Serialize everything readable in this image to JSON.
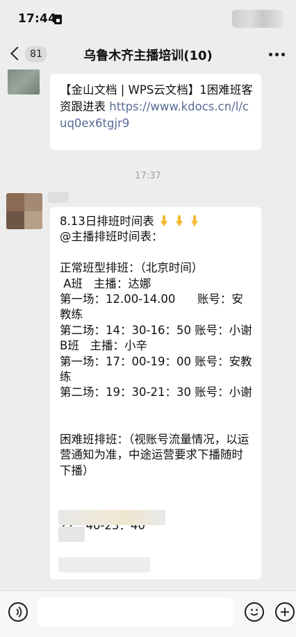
{
  "status_bar": {
    "time": "17:44"
  },
  "nav": {
    "unread_count": "81",
    "title": "乌鲁木齐主播培训(10)"
  },
  "messages": [
    {
      "type": "text",
      "text_prefix": "【金山文档 | WPS云文档】1困难班客资跟进表 ",
      "link": "https://www.kdocs.cn/l/cuq0ex6tgjr9"
    },
    {
      "type": "timestamp",
      "text": "17:37"
    },
    {
      "type": "text",
      "line1": "8.13日排班时间表",
      "emoji": [
        "pointing-down",
        "pointing-down",
        "pointing-down"
      ],
      "body": "@主播排班时间表：\n\n正常班型排班：（北京时间）\n A班   主播：达娜\n第一场：12.00-14.00      账号：安教练\n第二场：14：30-16：50 账号：小谢\nB班   主播：小辛\n第一场：17：00-19：00 账号：安教练\n第二场：19：30-21：30 账号：小谢\n\n\n困难班排班：（视账号流量情况，以运营通知为准，中途运营要求下播随时下播）",
      "time_range": "21：40-23：40"
    }
  ],
  "colors": {
    "link": "#576b95",
    "background": "#ededed",
    "bubble": "#ffffff",
    "emoji": "#f5b731"
  },
  "icons": [
    "back-chevron-icon",
    "more-icon",
    "voice-icon",
    "emoji-icon",
    "add-icon"
  ]
}
